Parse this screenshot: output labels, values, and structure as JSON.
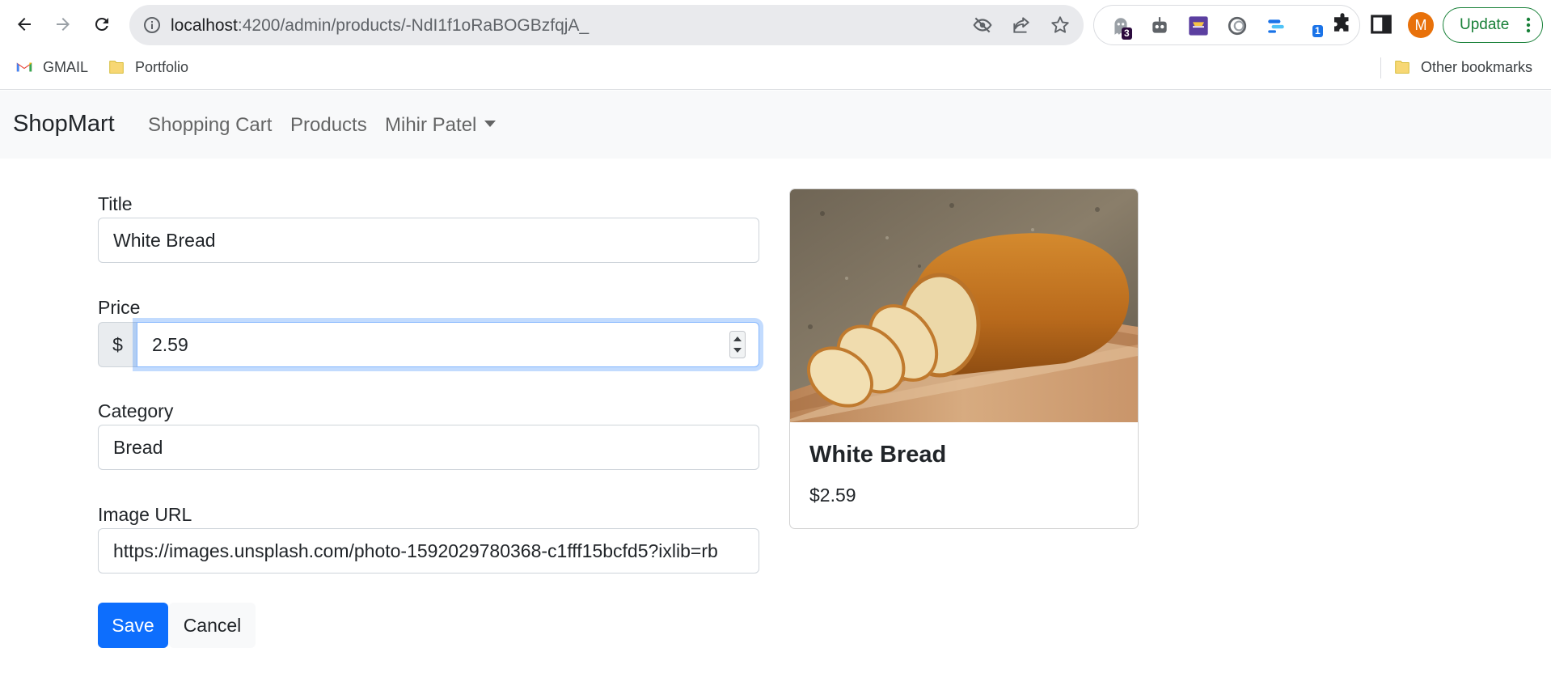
{
  "browser": {
    "url_host": "localhost",
    "url_path": ":4200/admin/products/-NdI1f1oRaBOGBzfqjA_",
    "ext_badges": [
      "3",
      "1"
    ],
    "profile_initial": "M",
    "update_label": "Update",
    "bookmarks": [
      "GMAIL",
      "Portfolio"
    ],
    "other_bookmarks": "Other bookmarks"
  },
  "navbar": {
    "brand": "ShopMart",
    "links": [
      "Shopping Cart",
      "Products"
    ],
    "user": "Mihir Patel"
  },
  "form": {
    "title_label": "Title",
    "title_value": "White Bread",
    "price_label": "Price",
    "currency_symbol": "$",
    "price_value": "2.59",
    "category_label": "Category",
    "category_value": "Bread",
    "image_label": "Image URL",
    "image_value": "https://images.unsplash.com/photo-1592029780368-c1fff15bcfd5?ixlib=rb",
    "save_label": "Save",
    "cancel_label": "Cancel"
  },
  "preview": {
    "title": "White Bread",
    "price": "$2.59"
  },
  "colors": {
    "primary": "#0d6efd",
    "navbar_bg": "#f8f9fa",
    "update_green": "#188038",
    "avatar_orange": "#e8710a"
  }
}
